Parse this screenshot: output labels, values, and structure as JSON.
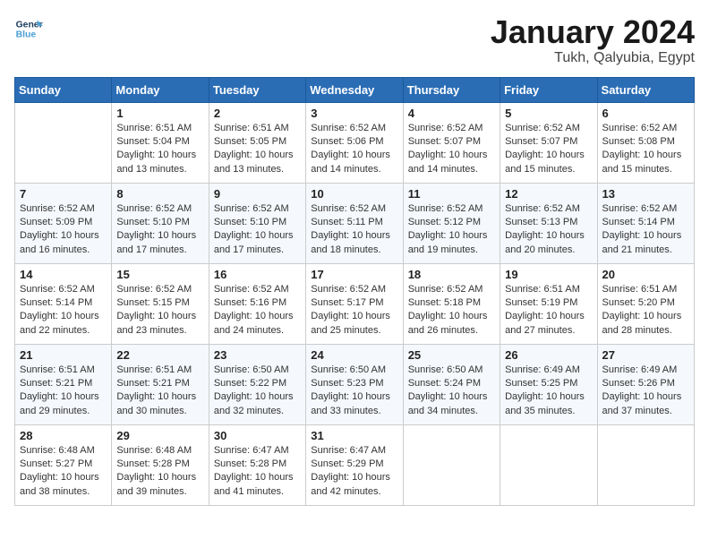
{
  "header": {
    "logo_line1": "General",
    "logo_line2": "Blue",
    "month": "January 2024",
    "location": "Tukh, Qalyubia, Egypt"
  },
  "days_of_week": [
    "Sunday",
    "Monday",
    "Tuesday",
    "Wednesday",
    "Thursday",
    "Friday",
    "Saturday"
  ],
  "weeks": [
    [
      {
        "day": "",
        "sunrise": "",
        "sunset": "",
        "daylight": ""
      },
      {
        "day": "1",
        "sunrise": "Sunrise: 6:51 AM",
        "sunset": "Sunset: 5:04 PM",
        "daylight": "Daylight: 10 hours and 13 minutes."
      },
      {
        "day": "2",
        "sunrise": "Sunrise: 6:51 AM",
        "sunset": "Sunset: 5:05 PM",
        "daylight": "Daylight: 10 hours and 13 minutes."
      },
      {
        "day": "3",
        "sunrise": "Sunrise: 6:52 AM",
        "sunset": "Sunset: 5:06 PM",
        "daylight": "Daylight: 10 hours and 14 minutes."
      },
      {
        "day": "4",
        "sunrise": "Sunrise: 6:52 AM",
        "sunset": "Sunset: 5:07 PM",
        "daylight": "Daylight: 10 hours and 14 minutes."
      },
      {
        "day": "5",
        "sunrise": "Sunrise: 6:52 AM",
        "sunset": "Sunset: 5:07 PM",
        "daylight": "Daylight: 10 hours and 15 minutes."
      },
      {
        "day": "6",
        "sunrise": "Sunrise: 6:52 AM",
        "sunset": "Sunset: 5:08 PM",
        "daylight": "Daylight: 10 hours and 15 minutes."
      }
    ],
    [
      {
        "day": "7",
        "sunrise": "Sunrise: 6:52 AM",
        "sunset": "Sunset: 5:09 PM",
        "daylight": "Daylight: 10 hours and 16 minutes."
      },
      {
        "day": "8",
        "sunrise": "Sunrise: 6:52 AM",
        "sunset": "Sunset: 5:10 PM",
        "daylight": "Daylight: 10 hours and 17 minutes."
      },
      {
        "day": "9",
        "sunrise": "Sunrise: 6:52 AM",
        "sunset": "Sunset: 5:10 PM",
        "daylight": "Daylight: 10 hours and 17 minutes."
      },
      {
        "day": "10",
        "sunrise": "Sunrise: 6:52 AM",
        "sunset": "Sunset: 5:11 PM",
        "daylight": "Daylight: 10 hours and 18 minutes."
      },
      {
        "day": "11",
        "sunrise": "Sunrise: 6:52 AM",
        "sunset": "Sunset: 5:12 PM",
        "daylight": "Daylight: 10 hours and 19 minutes."
      },
      {
        "day": "12",
        "sunrise": "Sunrise: 6:52 AM",
        "sunset": "Sunset: 5:13 PM",
        "daylight": "Daylight: 10 hours and 20 minutes."
      },
      {
        "day": "13",
        "sunrise": "Sunrise: 6:52 AM",
        "sunset": "Sunset: 5:14 PM",
        "daylight": "Daylight: 10 hours and 21 minutes."
      }
    ],
    [
      {
        "day": "14",
        "sunrise": "Sunrise: 6:52 AM",
        "sunset": "Sunset: 5:14 PM",
        "daylight": "Daylight: 10 hours and 22 minutes."
      },
      {
        "day": "15",
        "sunrise": "Sunrise: 6:52 AM",
        "sunset": "Sunset: 5:15 PM",
        "daylight": "Daylight: 10 hours and 23 minutes."
      },
      {
        "day": "16",
        "sunrise": "Sunrise: 6:52 AM",
        "sunset": "Sunset: 5:16 PM",
        "daylight": "Daylight: 10 hours and 24 minutes."
      },
      {
        "day": "17",
        "sunrise": "Sunrise: 6:52 AM",
        "sunset": "Sunset: 5:17 PM",
        "daylight": "Daylight: 10 hours and 25 minutes."
      },
      {
        "day": "18",
        "sunrise": "Sunrise: 6:52 AM",
        "sunset": "Sunset: 5:18 PM",
        "daylight": "Daylight: 10 hours and 26 minutes."
      },
      {
        "day": "19",
        "sunrise": "Sunrise: 6:51 AM",
        "sunset": "Sunset: 5:19 PM",
        "daylight": "Daylight: 10 hours and 27 minutes."
      },
      {
        "day": "20",
        "sunrise": "Sunrise: 6:51 AM",
        "sunset": "Sunset: 5:20 PM",
        "daylight": "Daylight: 10 hours and 28 minutes."
      }
    ],
    [
      {
        "day": "21",
        "sunrise": "Sunrise: 6:51 AM",
        "sunset": "Sunset: 5:21 PM",
        "daylight": "Daylight: 10 hours and 29 minutes."
      },
      {
        "day": "22",
        "sunrise": "Sunrise: 6:51 AM",
        "sunset": "Sunset: 5:21 PM",
        "daylight": "Daylight: 10 hours and 30 minutes."
      },
      {
        "day": "23",
        "sunrise": "Sunrise: 6:50 AM",
        "sunset": "Sunset: 5:22 PM",
        "daylight": "Daylight: 10 hours and 32 minutes."
      },
      {
        "day": "24",
        "sunrise": "Sunrise: 6:50 AM",
        "sunset": "Sunset: 5:23 PM",
        "daylight": "Daylight: 10 hours and 33 minutes."
      },
      {
        "day": "25",
        "sunrise": "Sunrise: 6:50 AM",
        "sunset": "Sunset: 5:24 PM",
        "daylight": "Daylight: 10 hours and 34 minutes."
      },
      {
        "day": "26",
        "sunrise": "Sunrise: 6:49 AM",
        "sunset": "Sunset: 5:25 PM",
        "daylight": "Daylight: 10 hours and 35 minutes."
      },
      {
        "day": "27",
        "sunrise": "Sunrise: 6:49 AM",
        "sunset": "Sunset: 5:26 PM",
        "daylight": "Daylight: 10 hours and 37 minutes."
      }
    ],
    [
      {
        "day": "28",
        "sunrise": "Sunrise: 6:48 AM",
        "sunset": "Sunset: 5:27 PM",
        "daylight": "Daylight: 10 hours and 38 minutes."
      },
      {
        "day": "29",
        "sunrise": "Sunrise: 6:48 AM",
        "sunset": "Sunset: 5:28 PM",
        "daylight": "Daylight: 10 hours and 39 minutes."
      },
      {
        "day": "30",
        "sunrise": "Sunrise: 6:47 AM",
        "sunset": "Sunset: 5:28 PM",
        "daylight": "Daylight: 10 hours and 41 minutes."
      },
      {
        "day": "31",
        "sunrise": "Sunrise: 6:47 AM",
        "sunset": "Sunset: 5:29 PM",
        "daylight": "Daylight: 10 hours and 42 minutes."
      },
      {
        "day": "",
        "sunrise": "",
        "sunset": "",
        "daylight": ""
      },
      {
        "day": "",
        "sunrise": "",
        "sunset": "",
        "daylight": ""
      },
      {
        "day": "",
        "sunrise": "",
        "sunset": "",
        "daylight": ""
      }
    ]
  ]
}
